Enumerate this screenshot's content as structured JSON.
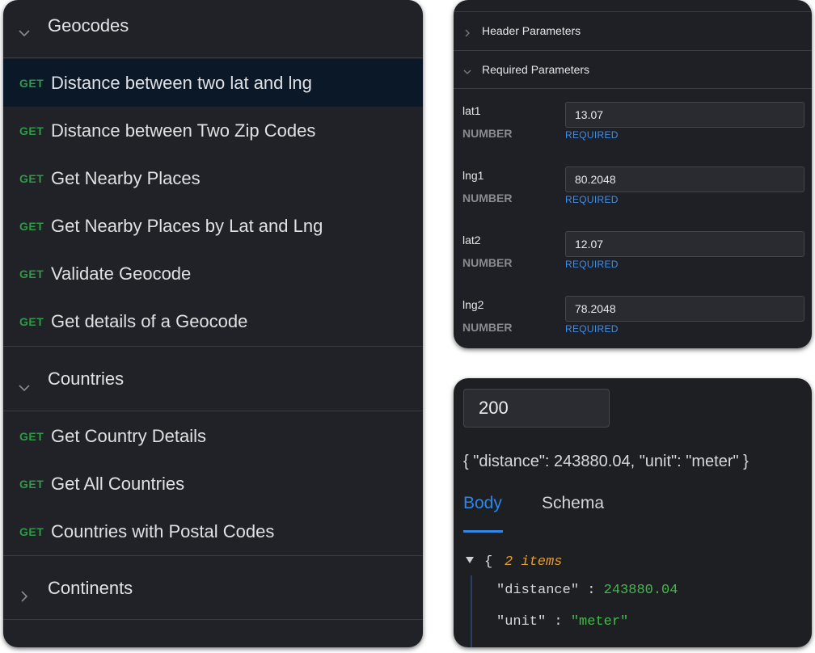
{
  "sidebar": {
    "groups": [
      {
        "title": "Geocodes",
        "expanded": true,
        "endpoints": [
          {
            "method": "GET",
            "label": "Distance between two lat and lng",
            "active": true
          },
          {
            "method": "GET",
            "label": "Distance between Two Zip Codes"
          },
          {
            "method": "GET",
            "label": "Get Nearby Places"
          },
          {
            "method": "GET",
            "label": "Get Nearby Places by Lat and Lng"
          },
          {
            "method": "GET",
            "label": "Validate Geocode"
          },
          {
            "method": "GET",
            "label": "Get details of a Geocode"
          }
        ]
      },
      {
        "title": "Countries",
        "expanded": true,
        "endpoints": [
          {
            "method": "GET",
            "label": "Get Country Details"
          },
          {
            "method": "GET",
            "label": "Get All Countries"
          },
          {
            "method": "GET",
            "label": "Countries with Postal Codes"
          }
        ]
      },
      {
        "title": "Continents",
        "expanded": false,
        "endpoints": []
      }
    ]
  },
  "params": {
    "header_section": "Header Parameters",
    "required_section": "Required Parameters",
    "items": [
      {
        "name": "lat1",
        "type": "NUMBER",
        "value": "13.07",
        "required": "REQUIRED"
      },
      {
        "name": "lng1",
        "type": "NUMBER",
        "value": "80.2048",
        "required": "REQUIRED"
      },
      {
        "name": "lat2",
        "type": "NUMBER",
        "value": "12.07",
        "required": "REQUIRED"
      },
      {
        "name": "lng2",
        "type": "NUMBER",
        "value": "78.2048",
        "required": "REQUIRED"
      }
    ]
  },
  "response": {
    "status": "200",
    "raw": "{ \"distance\": 243880.04, \"unit\": \"meter\" }",
    "tabs": {
      "body": "Body",
      "schema": "Schema"
    },
    "json": {
      "open_brace": "{",
      "count": "2 items",
      "fields": [
        {
          "key": "\"distance\"",
          "sep": ":",
          "value": "243880.04"
        },
        {
          "key": "\"unit\"",
          "sep": ":",
          "value": "\"meter\""
        }
      ]
    }
  },
  "colors": {
    "background": "#1f2025",
    "method_get": "#2f9a46",
    "required_link": "#3d8fe6",
    "active_tab": "#2f86e8",
    "json_value": "#43b94a",
    "json_count": "#e39a2f"
  },
  "icons": {
    "expanded": "chevron-down-icon",
    "collapsed": "chevron-right-icon"
  }
}
